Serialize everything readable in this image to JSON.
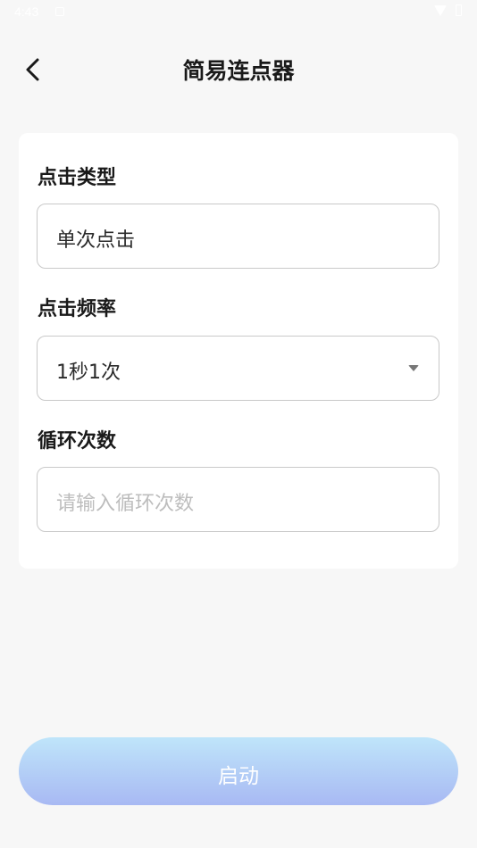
{
  "status_bar": {
    "time": "4:43"
  },
  "header": {
    "title": "简易连点器"
  },
  "form": {
    "click_type": {
      "label": "点击类型",
      "value": "单次点击"
    },
    "click_frequency": {
      "label": "点击频率",
      "value": "1秒1次"
    },
    "loop_count": {
      "label": "循环次数",
      "placeholder": "请输入循环次数"
    }
  },
  "actions": {
    "start_label": "启动"
  },
  "colors": {
    "background": "#f7f7f7",
    "card": "#ffffff",
    "button_gradient_top": "#bfe5fa",
    "button_gradient_bottom": "#a8b9f3"
  },
  "icons": {
    "back": "chevron-left-icon",
    "dropdown": "caret-down-icon"
  }
}
